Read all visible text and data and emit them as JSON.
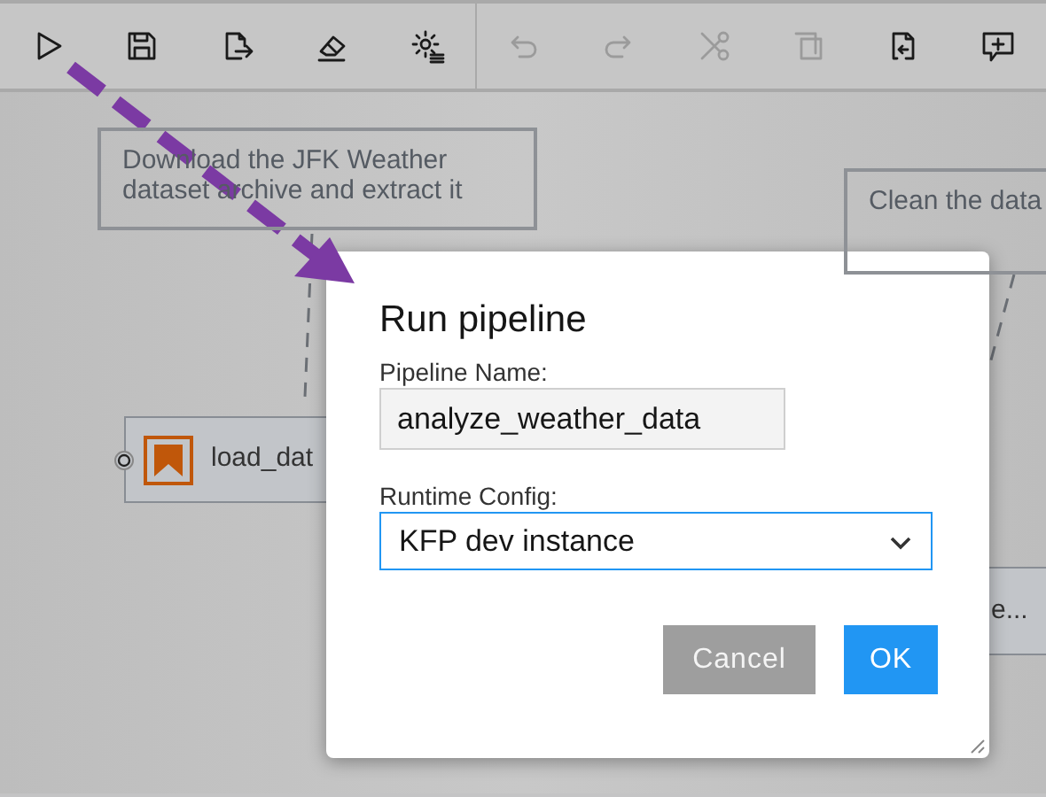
{
  "toolbar": [
    {
      "disabled": false
    },
    {
      "disabled": false
    },
    {
      "disabled": false
    },
    {
      "disabled": false
    },
    {
      "disabled": false
    },
    {
      "disabled": true
    },
    {
      "disabled": true
    },
    {
      "disabled": true
    },
    {
      "disabled": true
    },
    {
      "disabled": false
    },
    {
      "disabled": false
    }
  ],
  "canvas": {
    "comments": [
      "Download the JFK Weather dataset archive and extract it",
      "Clean the data"
    ],
    "nodes": [
      "load_dat",
      "e..."
    ]
  },
  "dialog": {
    "title": "Run pipeline",
    "fields": [
      {
        "kind": "text",
        "label": "Pipeline Name:",
        "value": "analyze_weather_data"
      },
      {
        "kind": "select",
        "label": "Runtime Config:",
        "value": "KFP dev instance"
      }
    ],
    "buttons": [
      {
        "label": "Cancel",
        "kind": "secondary"
      },
      {
        "label": "OK",
        "kind": "primary"
      }
    ]
  }
}
